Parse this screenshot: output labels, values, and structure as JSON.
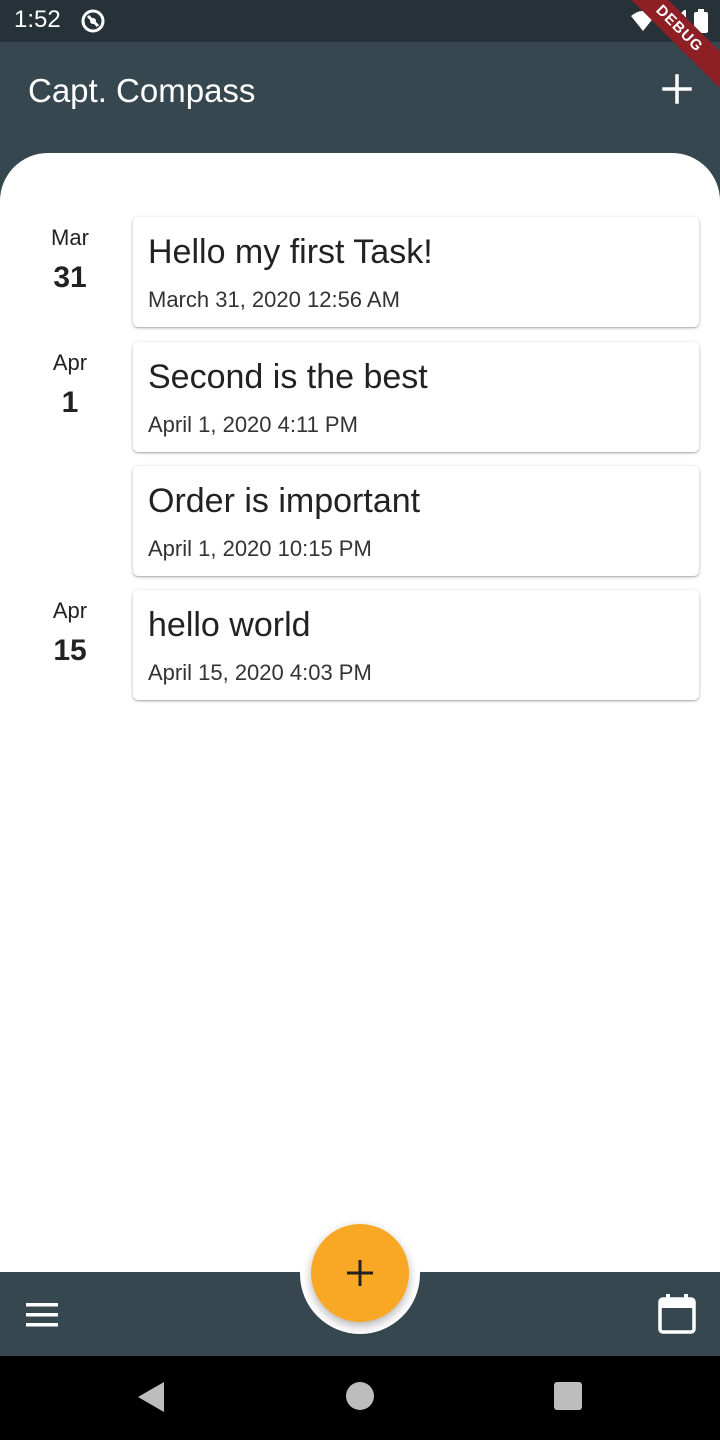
{
  "status": {
    "time": "1:52"
  },
  "debug_label": "DEBUG",
  "appbar": {
    "title": "Capt. Compass",
    "add_icon": "plus-icon"
  },
  "days": [
    {
      "month": "Mar",
      "day": "31"
    },
    {
      "month": "Apr",
      "day": "1"
    },
    {
      "month": "Apr",
      "day": "15"
    }
  ],
  "tasks": [
    {
      "title": "Hello my first Task!",
      "date": "March 31, 2020 12:56 AM"
    },
    {
      "title": "Second is the best",
      "date": "April 1, 2020 4:11 PM"
    },
    {
      "title": "Order is important",
      "date": "April 1, 2020 10:15 PM"
    },
    {
      "title": "hello world",
      "date": "April 15, 2020 4:03 PM"
    }
  ],
  "bottom": {
    "menu_icon": "menu-icon",
    "fab_icon": "plus-icon",
    "calendar_icon": "calendar-icon"
  },
  "colors": {
    "primary": "#37474f",
    "status_bar": "#263238",
    "accent": "#f9a825",
    "debug": "#8e1f25"
  }
}
